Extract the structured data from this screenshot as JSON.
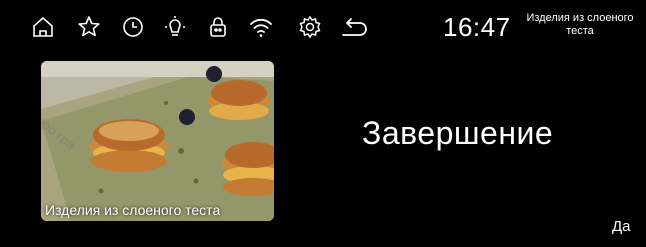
{
  "topbar": {
    "icons": [
      "home-icon",
      "favorite-star-icon",
      "timer-clock-icon",
      "light-bulb-icon",
      "child-lock-icon",
      "wifi-icon",
      "settings-gear-icon",
      "back-arrow-icon"
    ],
    "time": "16:47",
    "program_name": "Изделия из слоеного теста"
  },
  "recipe": {
    "caption": "Изделия из слоеного теста",
    "watermark": "о́ро гра"
  },
  "status": {
    "title": "Завершение"
  },
  "actions": {
    "confirm_label": "Да"
  }
}
